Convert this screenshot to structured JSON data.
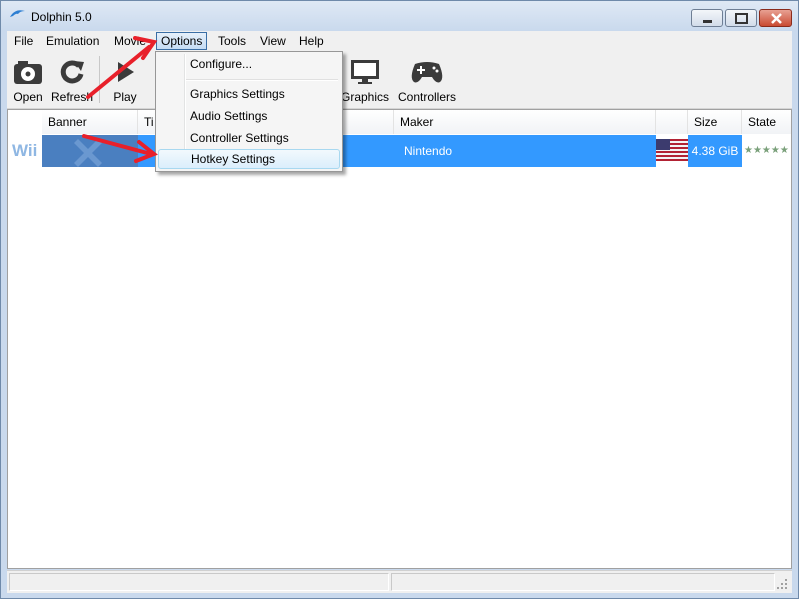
{
  "window": {
    "title": "Dolphin 5.0"
  },
  "menubar": {
    "items": [
      "File",
      "Emulation",
      "Movie",
      "Options",
      "Tools",
      "View",
      "Help"
    ]
  },
  "toolbar": {
    "open": "Open",
    "refresh": "Refresh",
    "play": "Play",
    "graphics": "Graphics",
    "controllers": "Controllers"
  },
  "options_menu": {
    "configure": "Configure...",
    "graphics_settings": "Graphics Settings",
    "audio_settings": "Audio Settings",
    "controller_settings": "Controller Settings",
    "hotkey_settings": "Hotkey Settings"
  },
  "game_list": {
    "columns": {
      "banner": "Banner",
      "title": "Ti",
      "maker": "Maker",
      "size": "Size",
      "state": "State"
    },
    "rows": [
      {
        "platform": "Wii",
        "maker": "Nintendo",
        "size": "4.38 GiB",
        "state": "★★★★★"
      }
    ]
  },
  "colors": {
    "selection": "#3399ff",
    "annotation_arrow": "#e8202a"
  }
}
